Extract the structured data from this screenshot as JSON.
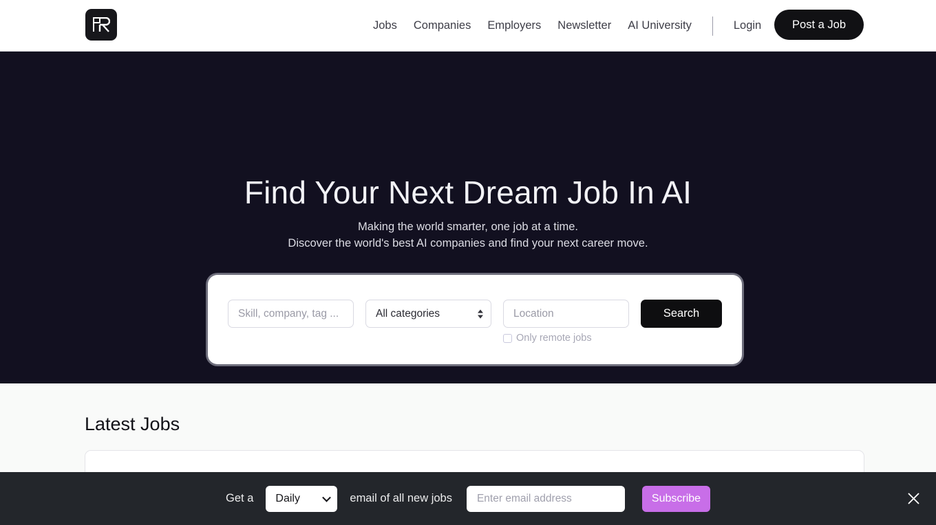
{
  "header": {
    "logo_icon": "pr-monogram-logo",
    "nav_items": [
      {
        "label": "Jobs"
      },
      {
        "label": "Companies"
      },
      {
        "label": "Employers"
      },
      {
        "label": "Newsletter"
      },
      {
        "label": "AI University"
      }
    ],
    "login_label": "Login",
    "post_job_label": "Post a Job"
  },
  "hero": {
    "title": "Find Your Next Dream Job In AI",
    "subtitle_line1": "Making the world smarter, one job at a time.",
    "subtitle_line2": "Discover the world's best AI companies and find your next career move.",
    "background_color": "#121020"
  },
  "search": {
    "skill_placeholder": "Skill, company, tag ...",
    "skill_value": "",
    "category_selected": "All categories",
    "category_options": [
      "All categories"
    ],
    "location_placeholder": "Location",
    "location_value": "",
    "remote_label": "Only remote jobs",
    "remote_checked": false,
    "search_button_label": "Search",
    "search_button_color": "#0e0e10"
  },
  "latest_jobs": {
    "heading": "Latest Jobs"
  },
  "subscribe": {
    "prefix_text": "Get a",
    "frequency_selected": "Daily",
    "frequency_options": [
      "Daily"
    ],
    "suffix_text": "email of all new jobs",
    "email_placeholder": "Enter email address",
    "email_value": "",
    "button_label": "Subscribe",
    "button_color": "#c86ee8",
    "close_icon": "close-icon",
    "bar_color": "#23262b"
  }
}
